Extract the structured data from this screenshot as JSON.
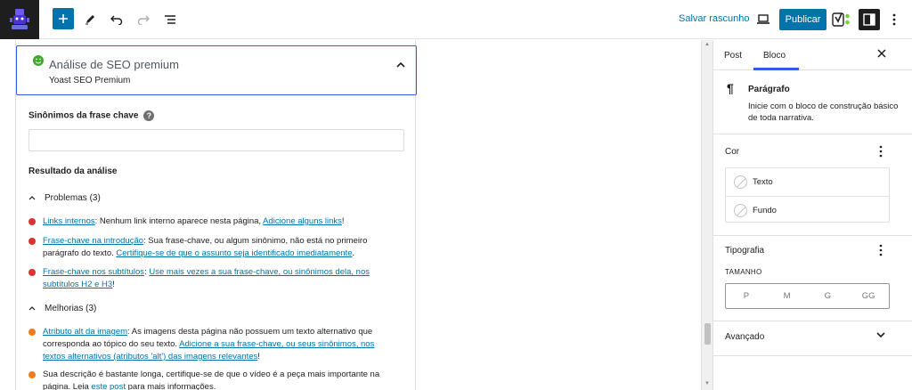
{
  "toolbar": {
    "save_draft": "Salvar rascunho",
    "publish": "Publicar"
  },
  "seo_panel": {
    "title": "Análise de SEO premium",
    "subtitle": "Yoast SEO Premium",
    "synonyms_label": "Sinônimos da frase chave",
    "results_label": "Resultado da análise",
    "problems_header": "Problemas (3)",
    "problems": [
      {
        "link": "Links internos",
        "text": ": Nenhum link interno aparece nesta página, ",
        "link2": "Adicione alguns links",
        "tail": "!"
      },
      {
        "link": "Frase-chave na introdução",
        "text": ": Sua frase-chave, ou algum sinônimo, não está no primeiro parágrafo do texto. ",
        "link2": "Certifique-se de que o assunto seja identificado imediatamente",
        "tail": "."
      },
      {
        "link": "Frase-chave nos subtítulos",
        "text": ": ",
        "link2": "Use mais vezes a sua frase-chave, ou sinônimos dela, nos subtítulos H2 e H3",
        "tail": "!"
      }
    ],
    "improvements_header": "Melhorias (3)",
    "improvements": [
      {
        "link": "Atributo alt da imagem",
        "text": ": As imagens desta página não possuem um texto alternativo que corresponda ao tópico do seu texto. ",
        "link2": "Adicione a sua frase-chave, ou seus sinônimos, nos textos alternativos (atributos 'alt') das imagens relevantes",
        "tail": "!"
      },
      {
        "text": "Sua descrição é bastante longa, certifique-se de que o vídeo é a peça mais importante na página. Leia ",
        "link2": "este post",
        "tail": " para mais informações."
      }
    ]
  },
  "sidebar": {
    "tab_post": "Post",
    "tab_block": "Bloco",
    "block_name": "Parágrafo",
    "block_desc": "Inicie com o bloco de construção básico de toda narrativa.",
    "color_title": "Cor",
    "color_text": "Texto",
    "color_bg": "Fundo",
    "typography_title": "Tipografia",
    "size_label": "TAMANHO",
    "sizes": [
      "P",
      "M",
      "G",
      "GG"
    ],
    "advanced_title": "Avançado"
  },
  "colors": {
    "accent": "#0073aa",
    "focus": "#3858e9",
    "good": "#7ad03a",
    "bad": "#dc3232",
    "ok": "#ee7c1b"
  }
}
